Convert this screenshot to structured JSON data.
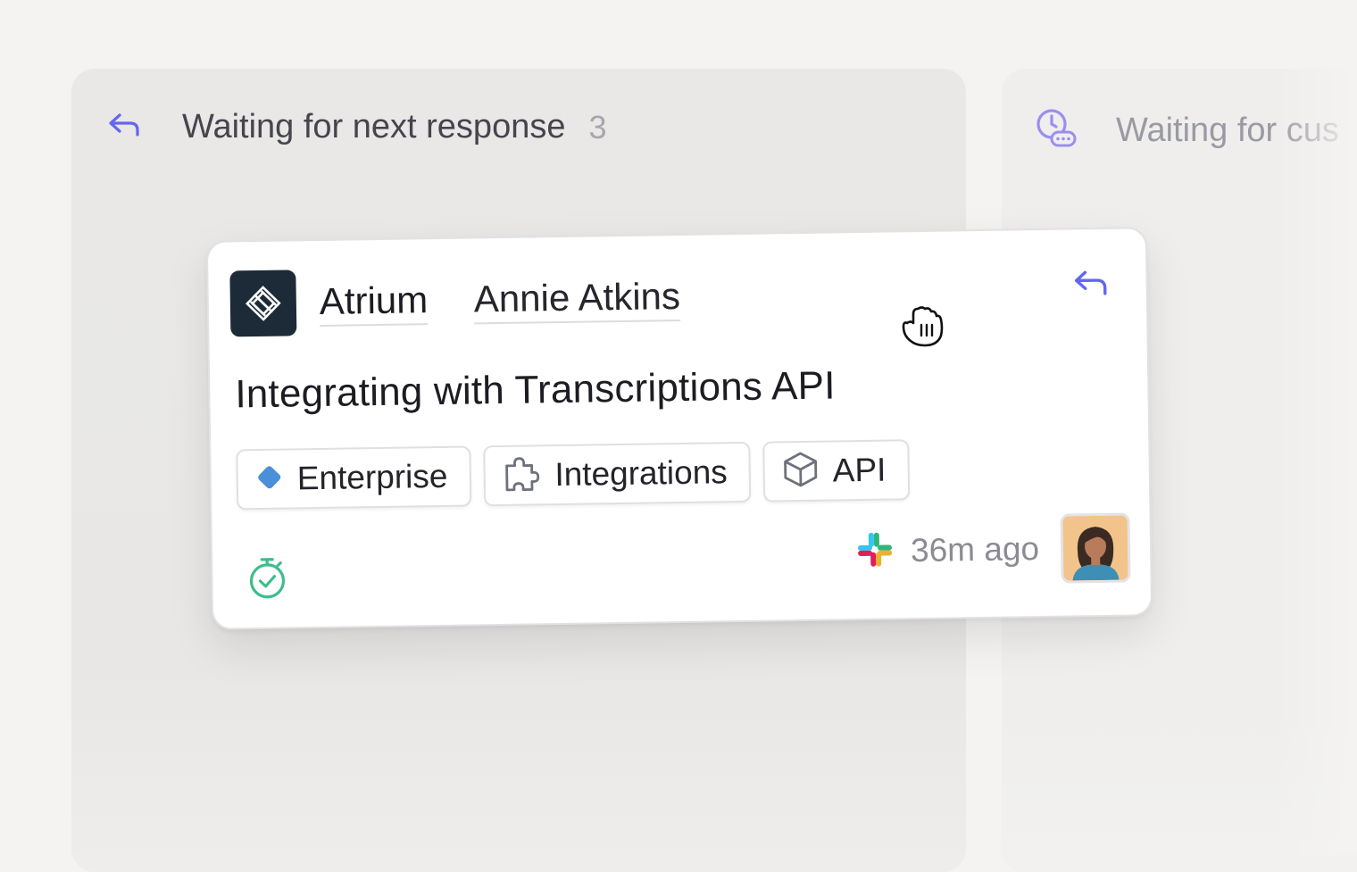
{
  "columns": [
    {
      "title": "Waiting for next response",
      "count": "3",
      "icon": "reply-arrow-icon"
    },
    {
      "title": "Waiting for cus",
      "icon": "clock-chat-icon"
    }
  ],
  "card": {
    "company": "Atrium",
    "contact": "Annie Atkins",
    "title": "Integrating with Transcriptions API",
    "tags": [
      {
        "label": "Enterprise",
        "icon": "diamond-icon",
        "color": "#4a90d9"
      },
      {
        "label": "Integrations",
        "icon": "puzzle-icon"
      },
      {
        "label": "API",
        "icon": "cube-icon"
      }
    ],
    "channel_icon": "slack-icon",
    "time_ago": "36m ago",
    "status_icon": "timer-check-icon"
  },
  "colors": {
    "accent": "#6366f1",
    "timer": "#3dbd8c",
    "logo_bg": "#1d2b38",
    "background": "#f4f3f2"
  }
}
